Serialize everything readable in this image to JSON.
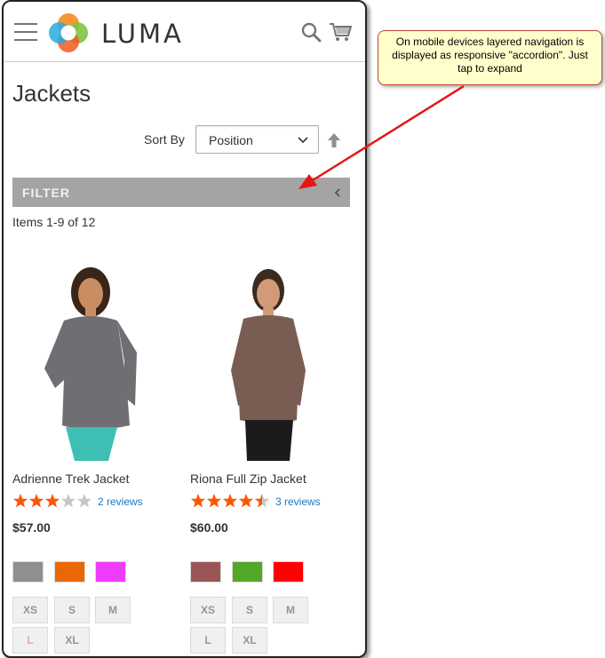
{
  "header": {
    "brand": "LUMA",
    "menu_icon": "hamburger-menu-icon",
    "search_icon": "search-icon",
    "cart_icon": "cart-icon"
  },
  "page_title": "Jackets",
  "toolbar": {
    "sort_label": "Sort By",
    "sort_value": "Position",
    "sort_direction_icon": "arrow-up-icon"
  },
  "filter": {
    "title": "FILTER",
    "icon": "chevron-left-icon"
  },
  "items_count": "Items 1-9 of 12",
  "products": [
    {
      "name": "Adrienne Trek Jacket",
      "rating_stars": 3,
      "reviews": "2 reviews",
      "price": "$57.00",
      "colors": [
        "#8f8f8f",
        "#eb6703",
        "#ef3dff"
      ],
      "sizes": [
        "XS",
        "S",
        "M",
        "L",
        "XL"
      ],
      "jacket_color": "#6e6e73",
      "pants_color": "#3fbfb3"
    },
    {
      "name": "Riona Full Zip Jacket",
      "rating_stars": 4.5,
      "reviews": "3 reviews",
      "price": "$60.00",
      "colors": [
        "#9a5656",
        "#53a828",
        "#ff0000"
      ],
      "sizes": [
        "XS",
        "S",
        "M",
        "L",
        "XL"
      ],
      "jacket_color": "#7a5d52",
      "pants_color": "#1b1b1b"
    }
  ],
  "callout": {
    "text": "On mobile devices layered navigation is displayed as responsive \"accordion\". Just tap to expand"
  },
  "colors": {
    "star_filled": "#ff5501",
    "star_empty": "#c7c7c7",
    "link": "#1979c3",
    "filter_bg": "#a4a4a4",
    "callout_bg": "#ffffcc",
    "arrow": "#e81515"
  }
}
